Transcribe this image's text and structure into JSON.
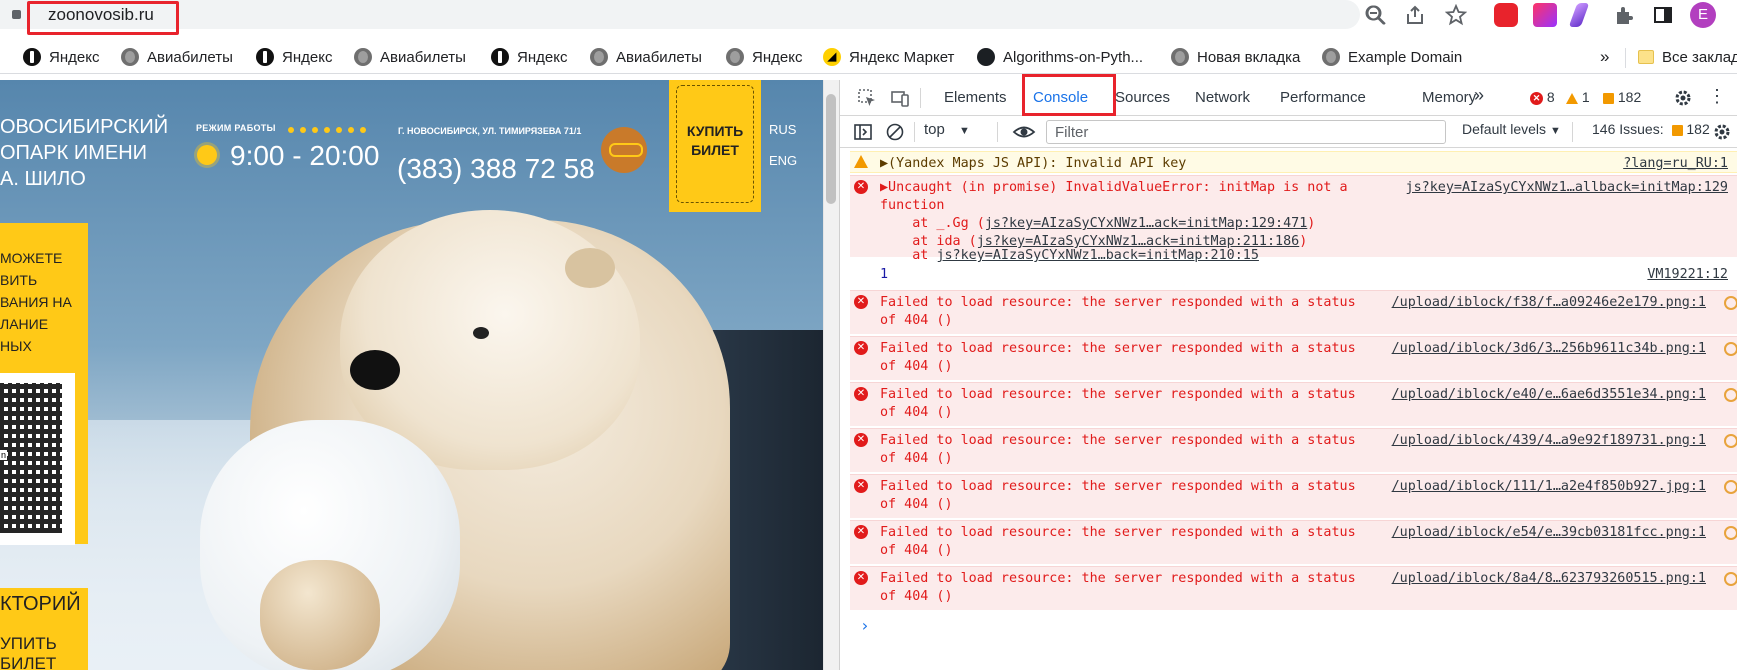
{
  "browser": {
    "url": "zoonovosib.ru",
    "bookmarks": [
      {
        "label": "Яндекс",
        "icon": "yandex-icon"
      },
      {
        "label": "Авиабилеты",
        "icon": "globe-icon"
      },
      {
        "label": "Яндекс",
        "icon": "yandex-icon"
      },
      {
        "label": "Авиабилеты",
        "icon": "globe-icon"
      },
      {
        "label": "Яндекс",
        "icon": "yandex-icon"
      },
      {
        "label": "Авиабилеты",
        "icon": "globe-icon"
      },
      {
        "label": "Яндекс",
        "icon": "globe-icon"
      },
      {
        "label": "Яндекс Маркет",
        "icon": "yandex-market-icon"
      },
      {
        "label": "Algorithms-on-Pyth...",
        "icon": "github-icon"
      },
      {
        "label": "Новая вкладка",
        "icon": "globe-icon"
      },
      {
        "label": "Example Domain",
        "icon": "globe-icon"
      }
    ],
    "bookmarks_overflow": "»",
    "all_bookmarks": "Все заклад",
    "profile_initial": "E"
  },
  "site": {
    "title_lines": [
      "НОВОСИБИРСКИЙ",
      "ЗООПАРК ИМЕНИ",
      "Р.А. ШИЛО"
    ],
    "title_visible": [
      "ОВОСИБИРСКИЙ",
      "ОПАРК ИМЕНИ",
      "А. ШИЛО"
    ],
    "hours_label": "РЕЖИМ РАБОТЫ",
    "hours": "9:00 - 20:00",
    "address": "Г. НОВОСИБИРСК, УЛ. ТИМИРЯЗЕВА 71/1",
    "phone": "(383) 388 72 58",
    "buy_ticket": "КУПИТЬ БИЛЕТ",
    "lang_ru": "RUS",
    "lang_en": "ENG",
    "left_panel": [
      "МОЖЕТЕ",
      "ВИТЬ",
      "ВАНИЯ НА",
      "ЛАНИЕ",
      "НЫХ"
    ],
    "qr_label": "n",
    "history": "КТОРИЙ",
    "buy2": [
      "УПИТЬ",
      "БИЛЕТ"
    ]
  },
  "devtools": {
    "tabs": [
      "Elements",
      "Console",
      "Sources",
      "Network",
      "Performance",
      "Memory"
    ],
    "more_tabs": "»",
    "errors_count": "8",
    "warnings_count": "1",
    "issues_badge": "182",
    "context": "top",
    "filter_placeholder": "Filter",
    "levels": "Default levels",
    "issues_label": "146 Issues:",
    "issues_count": "182",
    "messages": [
      {
        "type": "warning",
        "text": "▶(Yandex Maps JS API): Invalid API key",
        "source": "?lang=ru_RU:1"
      },
      {
        "type": "error",
        "line1": "▶Uncaught (in promise) InvalidValueError: initMap is not a",
        "line2": "function",
        "source": "js?key=AIzaSyCYxNWz1…allback=initMap:129",
        "stack": [
          {
            "prefix": "    at _.Gg (",
            "link": "js?key=AIzaSyCYxNWz1…ack=initMap:129:471",
            "suffix": ")"
          },
          {
            "prefix": "    at ida (",
            "link": "js?key=AIzaSyCYxNWz1…ack=initMap:211:186",
            "suffix": ")"
          },
          {
            "prefix": "    at ",
            "link": "js?key=AIzaSyCYxNWz1…back=initMap:210:15",
            "suffix": ""
          }
        ]
      },
      {
        "type": "log",
        "text": "1",
        "source": "VM19221:12"
      },
      {
        "type": "error404",
        "line1": "Failed to load resource: the server responded with a status",
        "line2": "of 404 ()",
        "source": "/upload/iblock/f38/f…a09246e2e179.png:1"
      },
      {
        "type": "error404",
        "line1": "Failed to load resource: the server responded with a status",
        "line2": "of 404 ()",
        "source": "/upload/iblock/3d6/3…256b9611c34b.png:1"
      },
      {
        "type": "error404",
        "line1": "Failed to load resource: the server responded with a status",
        "line2": "of 404 ()",
        "source": "/upload/iblock/e40/e…6ae6d3551e34.png:1"
      },
      {
        "type": "error404",
        "line1": "Failed to load resource: the server responded with a status",
        "line2": "of 404 ()",
        "source": "/upload/iblock/439/4…a9e92f189731.png:1"
      },
      {
        "type": "error404",
        "line1": "Failed to load resource: the server responded with a status",
        "line2": "of 404 ()",
        "source": "/upload/iblock/111/1…a2e4f850b927.jpg:1"
      },
      {
        "type": "error404",
        "line1": "Failed to load resource: the server responded with a status",
        "line2": "of 404 ()",
        "source": "/upload/iblock/e54/e…39cb03181fcc.png:1"
      },
      {
        "type": "error404",
        "line1": "Failed to load resource: the server responded with a status",
        "line2": "of 404 ()",
        "source": "/upload/iblock/8a4/8…623793260515.png:1"
      }
    ],
    "prompt": "›"
  },
  "colors": {
    "accent_red_highlight": "#e8232c",
    "zoo_yellow": "#ffc917",
    "error_red": "#e11b1b",
    "devtools_blue": "#1a73e8"
  }
}
